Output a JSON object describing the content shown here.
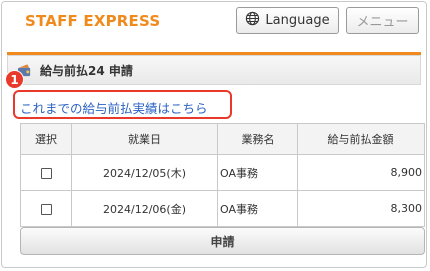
{
  "header": {
    "brand": "STAFF EXPRESS",
    "language_label": "Language",
    "menu_label": "メニュー"
  },
  "page": {
    "title": "給与前払24 申請",
    "history_link": "これまでの給与前払実績はこちら",
    "annotation_number": "1"
  },
  "table": {
    "columns": [
      "選択",
      "就業日",
      "業務名",
      "給与前払金額"
    ],
    "rows": [
      {
        "date": "2024/12/05(木)",
        "job": "OA事務",
        "amount": "8,900"
      },
      {
        "date": "2024/12/06(金)",
        "job": "OA事務",
        "amount": "8,300"
      }
    ]
  },
  "submit_label": "申請",
  "colors": {
    "brand": "#f08a1d",
    "link": "#2a63c4",
    "annotation": "#e8392b"
  },
  "icons": [
    "globe-icon",
    "wallet-icon"
  ]
}
